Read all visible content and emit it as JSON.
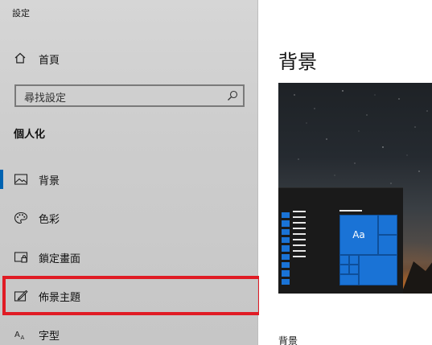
{
  "app": {
    "title": "設定"
  },
  "sidebar": {
    "home_label": "首頁",
    "home_icon": "home-icon",
    "search": {
      "placeholder": "尋找設定",
      "icon": "search-icon"
    },
    "section_heading": "個人化",
    "items": [
      {
        "label": "背景",
        "icon": "picture-icon",
        "selected": true
      },
      {
        "label": "色彩",
        "icon": "palette-icon",
        "selected": false
      },
      {
        "label": "鎖定畫面",
        "icon": "lock-screen-icon",
        "selected": false
      },
      {
        "label": "佈景主題",
        "icon": "theme-brush-icon",
        "selected": false
      },
      {
        "label": "字型",
        "icon": "font-icon",
        "selected": false
      }
    ]
  },
  "main": {
    "page_title": "背景",
    "preview": {
      "sample_text": "Aa"
    },
    "subheading": "背景"
  },
  "colors": {
    "accent": "#1a73d6",
    "highlight_border": "#e01b24",
    "selection_bar": "#0063b1"
  }
}
